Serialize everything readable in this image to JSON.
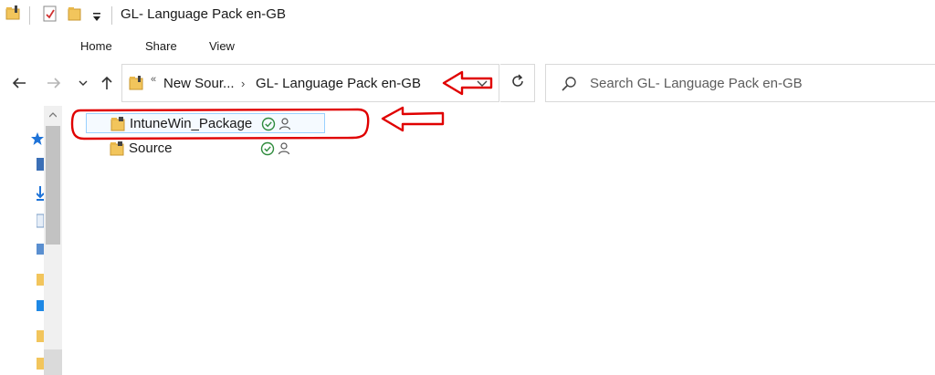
{
  "window": {
    "title": "GL- Language Pack en-GB"
  },
  "quick_access": {
    "icons": [
      "folder-properties-icon",
      "checklist-icon",
      "new-folder-icon",
      "customize-dropdown-icon"
    ]
  },
  "ribbon": {
    "tabs": [
      {
        "label": "Home"
      },
      {
        "label": "Share"
      },
      {
        "label": "View"
      }
    ]
  },
  "navigation": {
    "back_icon": "back-arrow-icon",
    "forward_icon": "forward-arrow-icon",
    "recent_icon": "chevron-down-icon",
    "up_icon": "up-arrow-icon"
  },
  "address": {
    "overflow": "«",
    "crumbs": [
      {
        "label": "New Sour..."
      },
      {
        "label": "GL- Language Pack en-GB"
      }
    ],
    "separator": "›"
  },
  "search": {
    "placeholder": "Search GL- Language Pack en-GB"
  },
  "files": [
    {
      "name": "IntuneWin_Package",
      "status": "synced",
      "shared": true,
      "selected": true
    },
    {
      "name": "Source",
      "status": "synced",
      "shared": true,
      "selected": false
    }
  ],
  "colors": {
    "annotation": "#e00000",
    "folder": "#f2c55c",
    "sync_green": "#2e8b3c",
    "selection_border": "#99d1ff"
  }
}
